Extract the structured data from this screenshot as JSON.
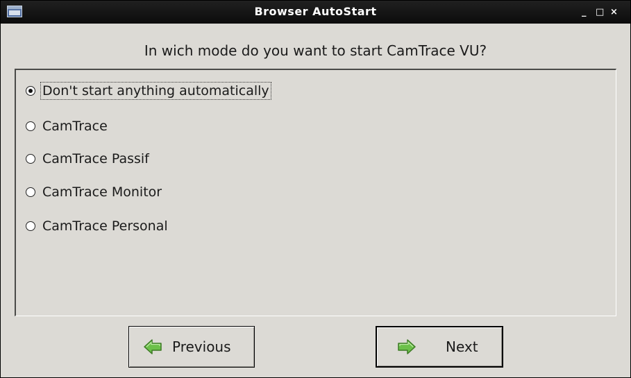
{
  "window": {
    "title": "Browser AutoStart",
    "controls": {
      "minimize": "_",
      "maximize": "□",
      "close": "×"
    }
  },
  "question": "In wich mode do you want to start CamTrace VU?",
  "options": [
    {
      "label": "Don't start anything automatically",
      "selected": true
    },
    {
      "label": "CamTrace",
      "selected": false
    },
    {
      "label": "CamTrace Passif",
      "selected": false
    },
    {
      "label": "CamTrace Monitor",
      "selected": false
    },
    {
      "label": "CamTrace Personal",
      "selected": false
    }
  ],
  "buttons": {
    "previous": {
      "label": "Previous",
      "icon": "arrow-left-icon"
    },
    "next": {
      "label": "Next",
      "icon": "arrow-right-icon"
    }
  },
  "colors": {
    "titlebar": "#111111",
    "background": "#dcdad5",
    "arrow_fill": "#6cc04a",
    "arrow_stroke": "#3d7a25"
  }
}
